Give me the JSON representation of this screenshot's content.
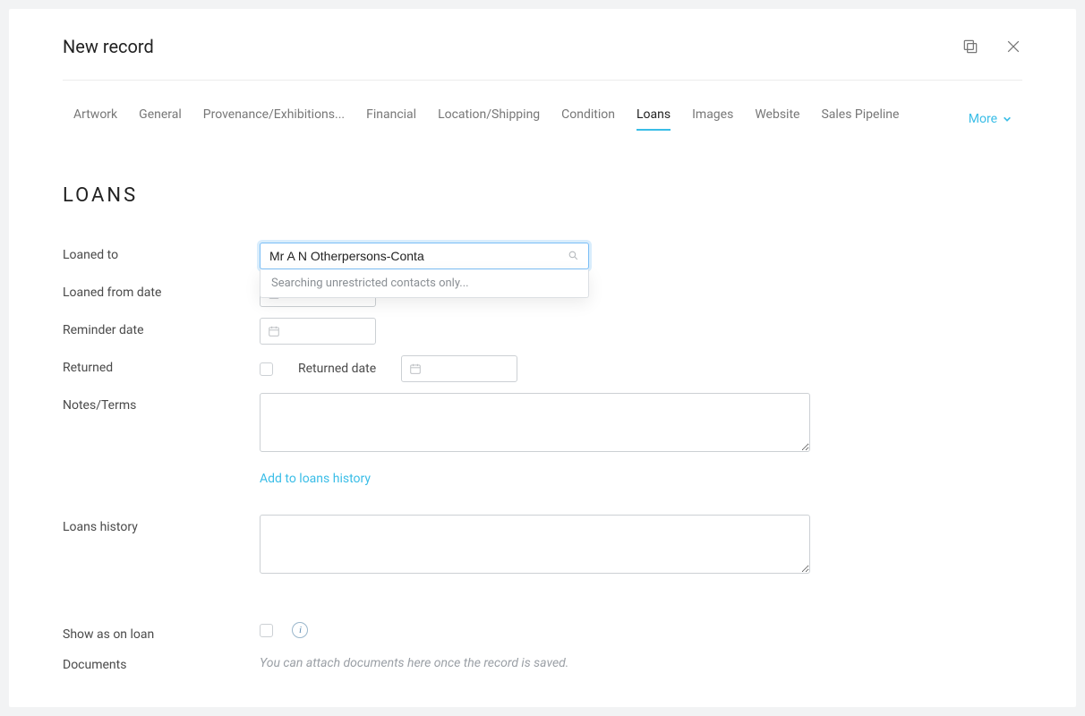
{
  "header": {
    "title": "New record"
  },
  "tabs": {
    "items": [
      {
        "label": "Artwork",
        "active": false
      },
      {
        "label": "General",
        "active": false
      },
      {
        "label": "Provenance/Exhibitions...",
        "active": false
      },
      {
        "label": "Financial",
        "active": false
      },
      {
        "label": "Location/Shipping",
        "active": false
      },
      {
        "label": "Condition",
        "active": false
      },
      {
        "label": "Loans",
        "active": true
      },
      {
        "label": "Images",
        "active": false
      },
      {
        "label": "Website",
        "active": false
      },
      {
        "label": "Sales Pipeline",
        "active": false
      }
    ],
    "more_label": "More"
  },
  "section": {
    "title": "Loans"
  },
  "form": {
    "loaned_to": {
      "label": "Loaned to",
      "value": "Mr A N Otherpersons-Conta",
      "dropdown_hint": "Searching unrestricted contacts only..."
    },
    "loaned_from_date": {
      "label": "Loaned from date"
    },
    "reminder_date": {
      "label": "Reminder date"
    },
    "returned": {
      "label": "Returned",
      "returned_date_label": "Returned date"
    },
    "notes": {
      "label": "Notes/Terms"
    },
    "add_history_action": "Add to loans history",
    "loans_history": {
      "label": "Loans history"
    },
    "show_on_loan": {
      "label": "Show as on loan",
      "info_char": "i"
    },
    "documents": {
      "label": "Documents",
      "helper": "You can attach documents here once the record is saved."
    }
  }
}
